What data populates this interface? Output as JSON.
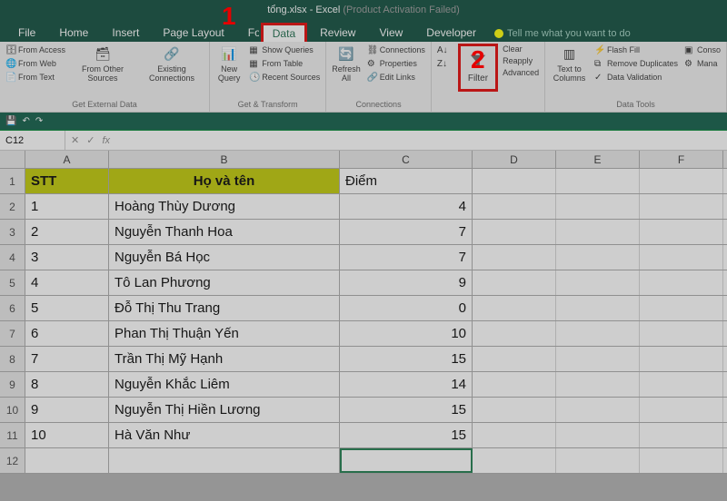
{
  "title": {
    "file": "tổng.xlsx",
    "app": "Excel",
    "status": "(Product Activation Failed)"
  },
  "tabs": [
    "File",
    "Home",
    "Insert",
    "Page Layout",
    "Formulas",
    "Data",
    "Review",
    "View",
    "Developer"
  ],
  "active_tab": "Data",
  "tell_me": "Tell me what you want to do",
  "ribbon": {
    "external": {
      "label": "Get External Data",
      "access": "From Access",
      "web": "From Web",
      "text": "From Text",
      "other": "From Other Sources",
      "existing": "Existing Connections"
    },
    "transform": {
      "label": "Get & Transform",
      "new_query": "New Query",
      "show_queries": "Show Queries",
      "from_table": "From Table",
      "recent": "Recent Sources"
    },
    "connections": {
      "label": "Connections",
      "refresh": "Refresh All",
      "conn": "Connections",
      "props": "Properties",
      "links": "Edit Links"
    },
    "sort_filter": {
      "filter": "Filter",
      "clear": "Clear",
      "reapply": "Reapply",
      "advanced": "Advanced"
    },
    "data_tools": {
      "label": "Data Tools",
      "text_cols": "Text to Columns",
      "flash": "Flash Fill",
      "dupes": "Remove Duplicates",
      "validation": "Data Validation",
      "conso": "Conso",
      "mana": "Mana"
    }
  },
  "namebox": "C12",
  "columns": [
    "A",
    "B",
    "C",
    "D",
    "E",
    "F"
  ],
  "headers": {
    "stt": "STT",
    "hoten": "Họ và tên",
    "diem": "Điểm"
  },
  "table_rows": [
    {
      "stt": "1",
      "name": "Hoàng Thùy Dương",
      "score": "4"
    },
    {
      "stt": "2",
      "name": "Nguyễn Thanh Hoa",
      "score": "7"
    },
    {
      "stt": "3",
      "name": "Nguyễn Bá Học",
      "score": "7"
    },
    {
      "stt": "4",
      "name": "Tô Lan Phương",
      "score": "9"
    },
    {
      "stt": "5",
      "name": "Đỗ Thị Thu Trang",
      "score": "0"
    },
    {
      "stt": "6",
      "name": "Phan Thị Thuận Yến",
      "score": "10"
    },
    {
      "stt": "7",
      "name": "Trần Thị Mỹ Hạnh",
      "score": "15"
    },
    {
      "stt": "8",
      "name": "Nguyễn Khắc Liêm",
      "score": "14"
    },
    {
      "stt": "9",
      "name": "Nguyễn Thị Hiền Lương",
      "score": "15"
    },
    {
      "stt": "10",
      "name": "Hà Văn Như",
      "score": "15"
    }
  ],
  "row_numbers": [
    "1",
    "2",
    "3",
    "4",
    "5",
    "6",
    "7",
    "8",
    "9",
    "10",
    "11",
    "12"
  ],
  "annotations": {
    "a1": "1",
    "a2": "2"
  }
}
